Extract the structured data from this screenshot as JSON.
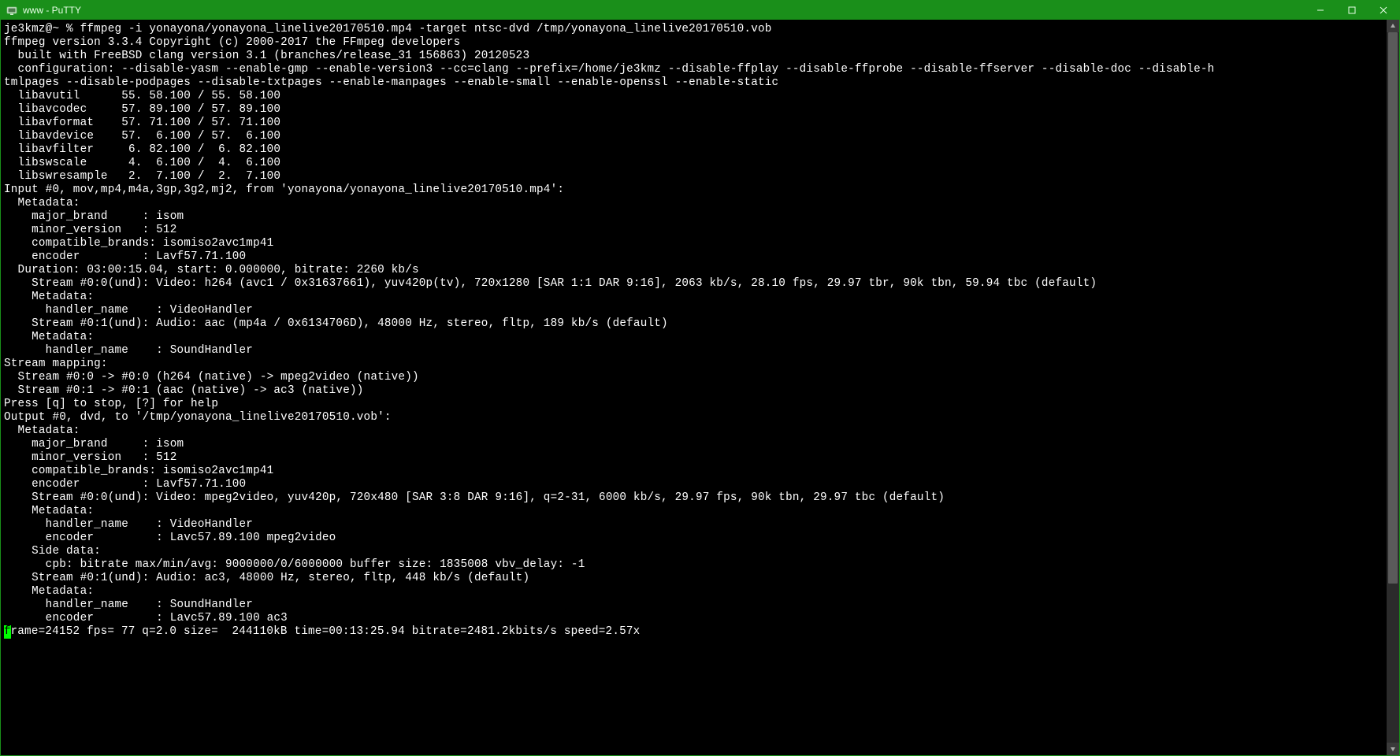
{
  "window": {
    "title": "www - PuTTY"
  },
  "terminal": {
    "lines": [
      "je3kmz@~ % ffmpeg -i yonayona/yonayona_linelive20170510.mp4 -target ntsc-dvd /tmp/yonayona_linelive20170510.vob",
      "ffmpeg version 3.3.4 Copyright (c) 2000-2017 the FFmpeg developers",
      "  built with FreeBSD clang version 3.1 (branches/release_31 156863) 20120523",
      "  configuration: --disable-yasm --enable-gmp --enable-version3 --cc=clang --prefix=/home/je3kmz --disable-ffplay --disable-ffprobe --disable-ffserver --disable-doc --disable-h",
      "tmlpages --disable-podpages --disable-txtpages --enable-manpages --enable-small --enable-openssl --enable-static",
      "  libavutil      55. 58.100 / 55. 58.100",
      "  libavcodec     57. 89.100 / 57. 89.100",
      "  libavformat    57. 71.100 / 57. 71.100",
      "  libavdevice    57.  6.100 / 57.  6.100",
      "  libavfilter     6. 82.100 /  6. 82.100",
      "  libswscale      4.  6.100 /  4.  6.100",
      "  libswresample   2.  7.100 /  2.  7.100",
      "Input #0, mov,mp4,m4a,3gp,3g2,mj2, from 'yonayona/yonayona_linelive20170510.mp4':",
      "  Metadata:",
      "    major_brand     : isom",
      "    minor_version   : 512",
      "    compatible_brands: isomiso2avc1mp41",
      "    encoder         : Lavf57.71.100",
      "  Duration: 03:00:15.04, start: 0.000000, bitrate: 2260 kb/s",
      "    Stream #0:0(und): Video: h264 (avc1 / 0x31637661), yuv420p(tv), 720x1280 [SAR 1:1 DAR 9:16], 2063 kb/s, 28.10 fps, 29.97 tbr, 90k tbn, 59.94 tbc (default)",
      "    Metadata:",
      "      handler_name    : VideoHandler",
      "    Stream #0:1(und): Audio: aac (mp4a / 0x6134706D), 48000 Hz, stereo, fltp, 189 kb/s (default)",
      "    Metadata:",
      "      handler_name    : SoundHandler",
      "Stream mapping:",
      "  Stream #0:0 -> #0:0 (h264 (native) -> mpeg2video (native))",
      "  Stream #0:1 -> #0:1 (aac (native) -> ac3 (native))",
      "Press [q] to stop, [?] for help",
      "Output #0, dvd, to '/tmp/yonayona_linelive20170510.vob':",
      "  Metadata:",
      "    major_brand     : isom",
      "    minor_version   : 512",
      "    compatible_brands: isomiso2avc1mp41",
      "    encoder         : Lavf57.71.100",
      "    Stream #0:0(und): Video: mpeg2video, yuv420p, 720x480 [SAR 3:8 DAR 9:16], q=2-31, 6000 kb/s, 29.97 fps, 90k tbn, 29.97 tbc (default)",
      "    Metadata:",
      "      handler_name    : VideoHandler",
      "      encoder         : Lavc57.89.100 mpeg2video",
      "    Side data:",
      "      cpb: bitrate max/min/avg: 9000000/0/6000000 buffer size: 1835008 vbv_delay: -1",
      "    Stream #0:1(und): Audio: ac3, 48000 Hz, stereo, fltp, 448 kb/s (default)",
      "    Metadata:",
      "      handler_name    : SoundHandler",
      "      encoder         : Lavc57.89.100 ac3"
    ],
    "status_first_char": "f",
    "status_rest": "rame=24152 fps= 77 q=2.0 size=  244110kB time=00:13:25.94 bitrate=2481.2kbits/s speed=2.57x"
  }
}
